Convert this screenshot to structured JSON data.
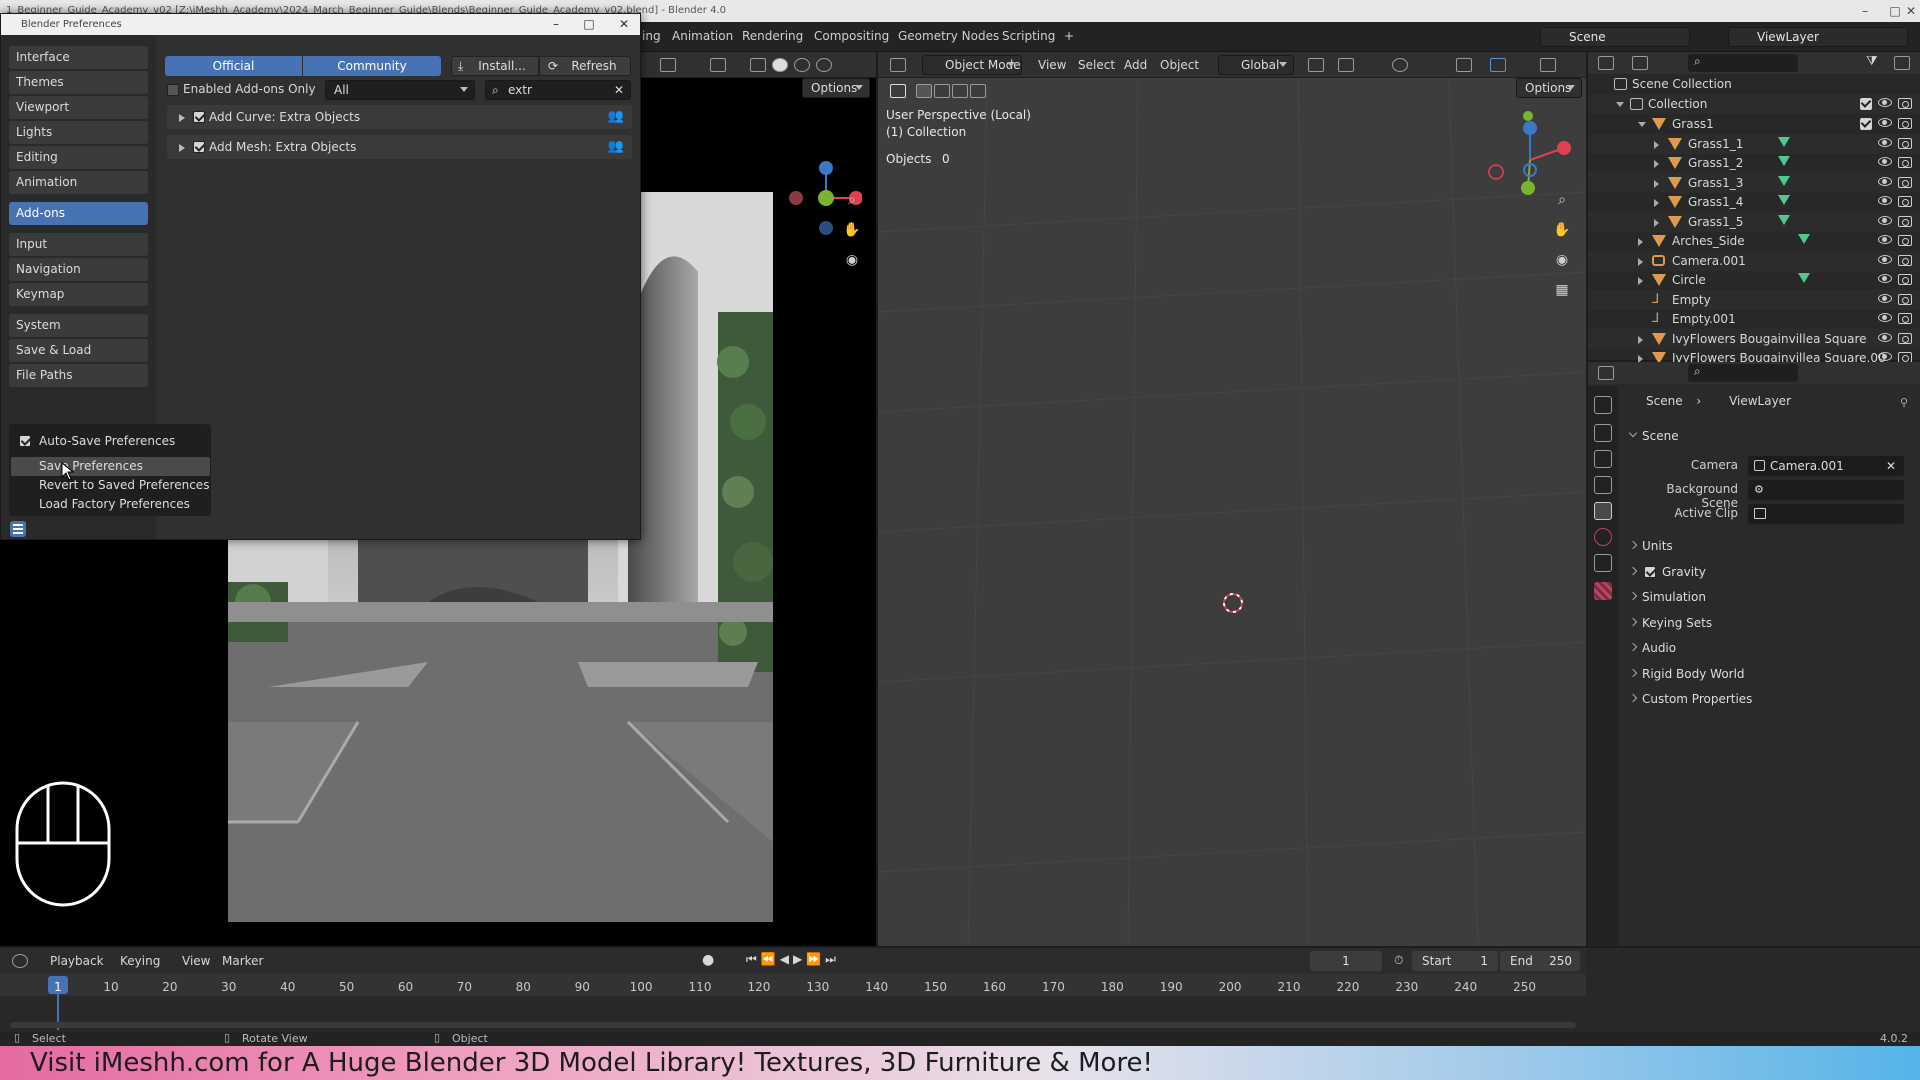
{
  "app": {
    "window_title": "1_Beginner_Guide_Academy_v02 [Z:\\iMeshh_Academy\\2024_March_Beginner_Guide\\Blends\\Beginner_Guide_Academy_v02.blend] - Blender 4.0",
    "version": "4.0.2"
  },
  "topbar": {
    "workspace_tabs": [
      "ing",
      "Animation",
      "Rendering",
      "Compositing",
      "Geometry Nodes",
      "Scripting",
      "+"
    ],
    "scene_label": "Scene",
    "viewlayer_label": "ViewLayer"
  },
  "prefs": {
    "title": "Blender Preferences",
    "categories_group1": [
      "Interface",
      "Themes",
      "Viewport",
      "Lights",
      "Editing",
      "Animation"
    ],
    "active_category": "Add-ons",
    "categories_group2": [
      "Input",
      "Navigation",
      "Keymap"
    ],
    "categories_group3": [
      "System",
      "Save & Load",
      "File Paths"
    ],
    "tab_official": "Official",
    "tab_community": "Community",
    "install_label": "Install...",
    "refresh_label": "Refresh",
    "enabled_only_label": "Enabled Add-ons Only",
    "filter_value": "All",
    "search_value": "extr",
    "addons": [
      "Add Curve: Extra Objects",
      "Add Mesh: Extra Objects"
    ],
    "menu": {
      "auto_save": "Auto-Save Preferences",
      "save": "Save Preferences",
      "revert": "Revert to Saved Preferences",
      "factory": "Load Factory Preferences"
    }
  },
  "left_viewport": {
    "options_label": "Options"
  },
  "mid_viewport": {
    "mode": "Object Mode",
    "menus": [
      "View",
      "Select",
      "Add",
      "Object"
    ],
    "transform": "Global",
    "options_label": "Options",
    "overlay_title": "User Perspective (Local)",
    "overlay_collection": "(1) Collection",
    "objects_label": "Objects",
    "objects_value": "0"
  },
  "outliner": {
    "root": "Scene Collection",
    "collection": "Collection",
    "rows": [
      {
        "name": "Grass1",
        "indent": 2,
        "expanded": true
      },
      {
        "name": "Grass1_1",
        "indent": 3
      },
      {
        "name": "Grass1_2",
        "indent": 3
      },
      {
        "name": "Grass1_3",
        "indent": 3
      },
      {
        "name": "Grass1_4",
        "indent": 3
      },
      {
        "name": "Grass1_5",
        "indent": 3
      },
      {
        "name": "Arches_Side",
        "indent": 2
      },
      {
        "name": "Camera.001",
        "indent": 2
      },
      {
        "name": "Circle",
        "indent": 2
      },
      {
        "name": "Empty",
        "indent": 2
      },
      {
        "name": "Empty.001",
        "indent": 2
      },
      {
        "name": "IvyFlowers Bougainvillea Square",
        "indent": 2
      },
      {
        "name": "IvyFlowers Bougainvillea Square.00",
        "indent": 2
      }
    ]
  },
  "properties": {
    "breadcrumb_scene": "Scene",
    "breadcrumb_viewlayer": "ViewLayer",
    "section_scene": "Scene",
    "camera_label": "Camera",
    "camera_value": "Camera.001",
    "bg_scene_label": "Background Scene",
    "active_clip_label": "Active Clip",
    "sections": [
      "Units",
      "Gravity",
      "Simulation",
      "Keying Sets",
      "Audio",
      "Rigid Body World",
      "Custom Properties"
    ]
  },
  "timeline": {
    "menus": [
      "Playback",
      "Keying",
      "View",
      "Marker"
    ],
    "current_frame": "1",
    "start_label": "Start",
    "start_value": "1",
    "end_label": "End",
    "end_value": "250",
    "ticks": [
      "1",
      "10",
      "20",
      "30",
      "40",
      "50",
      "60",
      "70",
      "80",
      "90",
      "100",
      "110",
      "120",
      "130",
      "140",
      "150",
      "160",
      "170",
      "180",
      "190",
      "200",
      "210",
      "220",
      "230",
      "240",
      "250"
    ]
  },
  "statusbar": {
    "select": "Select",
    "rotate": "Rotate View",
    "object": "Object"
  },
  "banner": {
    "text": "Visit iMeshh.com for A Huge Blender 3D Model Library! Textures, 3D Furniture & More!"
  },
  "colors": {
    "accent": "#4772b3",
    "axis_x": "#e0404f",
    "axis_y": "#7ab330",
    "axis_z": "#3a78c8"
  }
}
